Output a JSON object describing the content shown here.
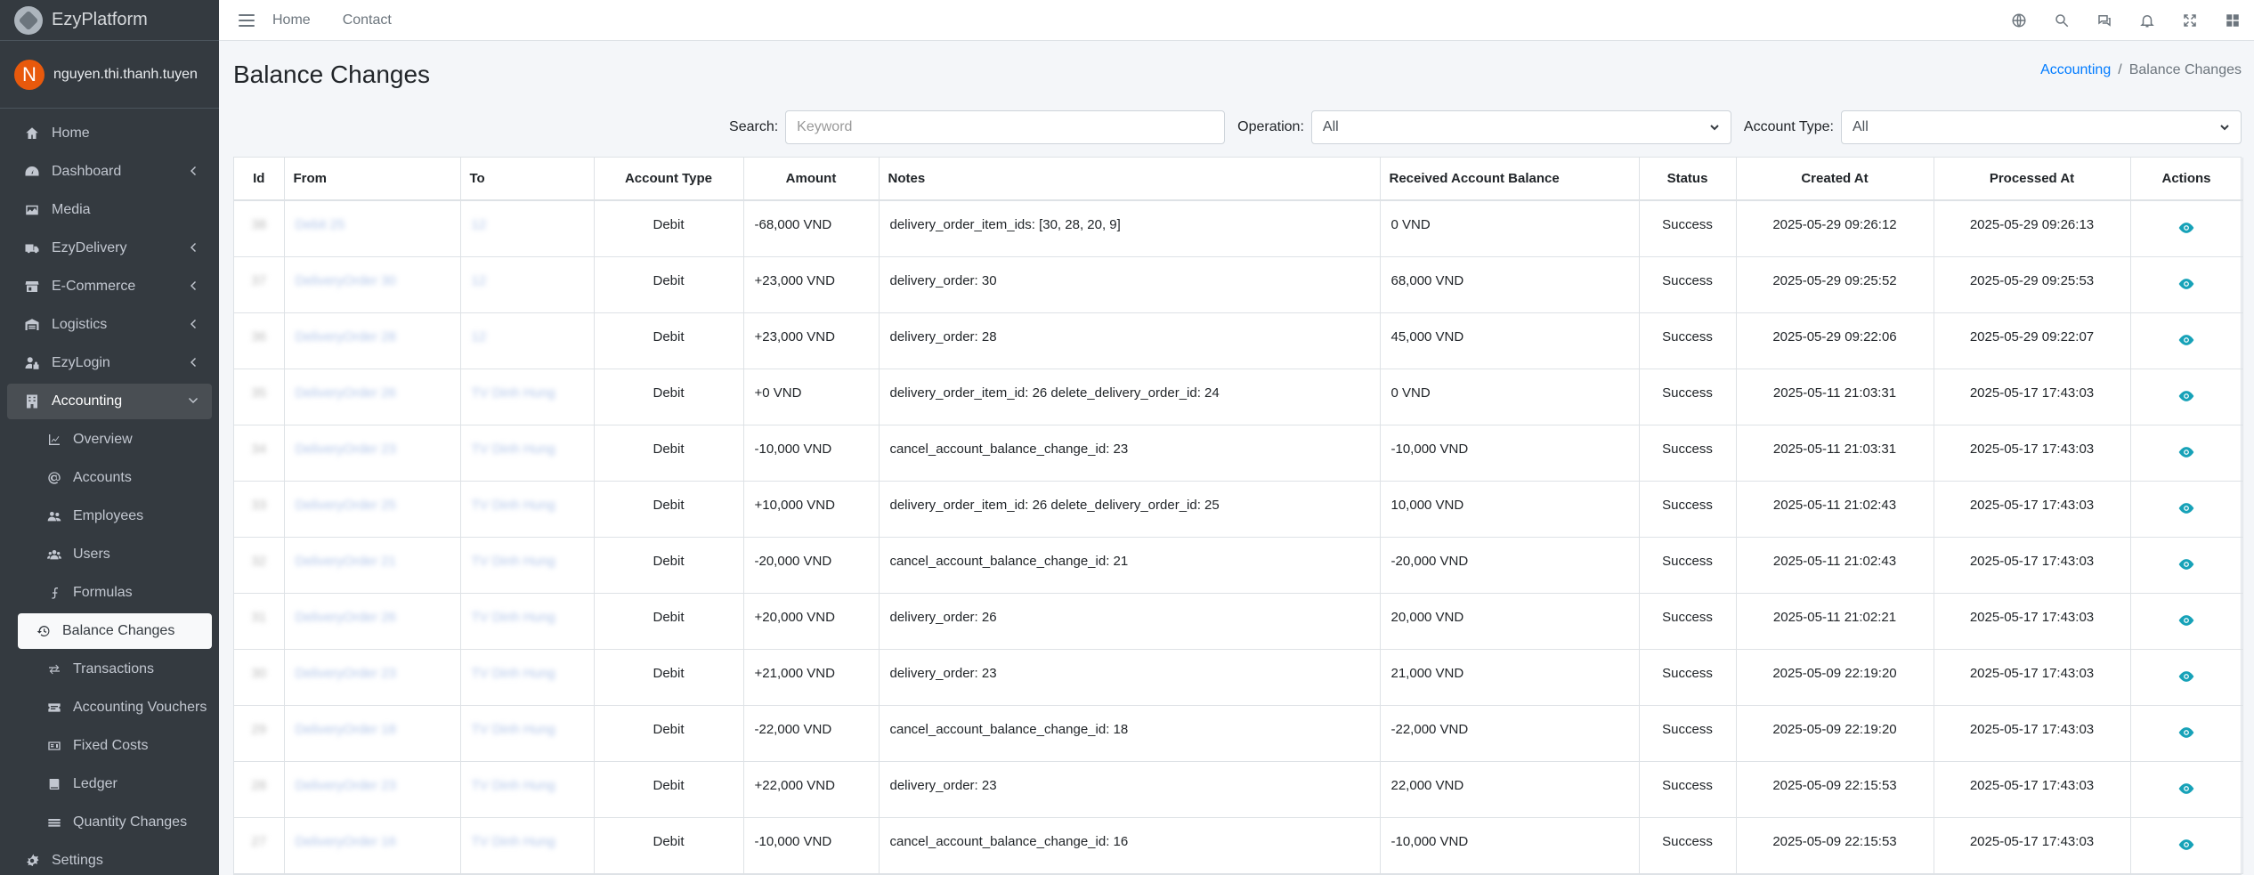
{
  "brand": {
    "name": "EzyPlatform"
  },
  "user": {
    "initial": "N",
    "name": "nguyen.thi.thanh.tuyen"
  },
  "sidebar": {
    "items": [
      {
        "label": "Home",
        "icon": "home-icon"
      },
      {
        "label": "Dashboard",
        "icon": "dashboard-icon",
        "chevron": true
      },
      {
        "label": "Media",
        "icon": "image-icon"
      },
      {
        "label": "EzyDelivery",
        "icon": "truck-icon",
        "chevron": true
      },
      {
        "label": "E-Commerce",
        "icon": "store-icon",
        "chevron": true
      },
      {
        "label": "Logistics",
        "icon": "warehouse-icon",
        "chevron": true
      },
      {
        "label": "EzyLogin",
        "icon": "user-lock-icon",
        "chevron": true
      },
      {
        "label": "Accounting",
        "icon": "building-icon",
        "chevron": true,
        "open": true
      }
    ],
    "accounting_sub": [
      "Overview",
      "Accounts",
      "Employees",
      "Users",
      "Formulas",
      "Balance Changes",
      "Transactions",
      "Accounting Vouchers",
      "Fixed Costs",
      "Ledger",
      "Quantity Changes"
    ],
    "settings": "Settings"
  },
  "topbar": {
    "home": "Home",
    "contact": "Contact"
  },
  "page": {
    "title": "Balance Changes"
  },
  "breadcrumb": {
    "parent": "Accounting",
    "separator": "/",
    "current": "Balance Changes"
  },
  "filters": {
    "search_label": "Search:",
    "search_placeholder": "Keyword",
    "operation_label": "Operation:",
    "operation_value": "All",
    "account_type_label": "Account Type:",
    "account_type_value": "All"
  },
  "table": {
    "headers": [
      "Id",
      "From",
      "To",
      "Account Type",
      "Amount",
      "Notes",
      "Received Account Balance",
      "Status",
      "Created At",
      "Processed At",
      "Actions"
    ],
    "rows": [
      {
        "id": "38",
        "from": "Debit 25",
        "to": "12",
        "type": "Debit",
        "amount": "-68,000 VND",
        "notes": "delivery_order_item_ids: [30, 28, 20, 9]",
        "balance": "0 VND",
        "status": "Success",
        "created": "2025-05-29 09:26:12",
        "processed": "2025-05-29 09:26:13"
      },
      {
        "id": "37",
        "from": "DeliveryOrder 30",
        "to": "12",
        "type": "Debit",
        "amount": "+23,000 VND",
        "notes": "delivery_order: 30",
        "balance": "68,000 VND",
        "status": "Success",
        "created": "2025-05-29 09:25:52",
        "processed": "2025-05-29 09:25:53"
      },
      {
        "id": "36",
        "from": "DeliveryOrder 28",
        "to": "12",
        "type": "Debit",
        "amount": "+23,000 VND",
        "notes": "delivery_order: 28",
        "balance": "45,000 VND",
        "status": "Success",
        "created": "2025-05-29 09:22:06",
        "processed": "2025-05-29 09:22:07"
      },
      {
        "id": "35",
        "from": "DeliveryOrder 26",
        "to": "TV Dinh Hung",
        "type": "Debit",
        "amount": "+0 VND",
        "notes": "delivery_order_item_id: 26 delete_delivery_order_id: 24",
        "balance": "0 VND",
        "status": "Success",
        "created": "2025-05-11 21:03:31",
        "processed": "2025-05-17 17:43:03"
      },
      {
        "id": "34",
        "from": "DeliveryOrder 23",
        "to": "TV Dinh Hung",
        "type": "Debit",
        "amount": "-10,000 VND",
        "notes": "cancel_account_balance_change_id: 23",
        "balance": "-10,000 VND",
        "status": "Success",
        "created": "2025-05-11 21:03:31",
        "processed": "2025-05-17 17:43:03"
      },
      {
        "id": "33",
        "from": "DeliveryOrder 25",
        "to": "TV Dinh Hung",
        "type": "Debit",
        "amount": "+10,000 VND",
        "notes": "delivery_order_item_id: 26 delete_delivery_order_id: 25",
        "balance": "10,000 VND",
        "status": "Success",
        "created": "2025-05-11 21:02:43",
        "processed": "2025-05-17 17:43:03"
      },
      {
        "id": "32",
        "from": "DeliveryOrder 21",
        "to": "TV Dinh Hung",
        "type": "Debit",
        "amount": "-20,000 VND",
        "notes": "cancel_account_balance_change_id: 21",
        "balance": "-20,000 VND",
        "status": "Success",
        "created": "2025-05-11 21:02:43",
        "processed": "2025-05-17 17:43:03"
      },
      {
        "id": "31",
        "from": "DeliveryOrder 26",
        "to": "TV Dinh Hung",
        "type": "Debit",
        "amount": "+20,000 VND",
        "notes": "delivery_order: 26",
        "balance": "20,000 VND",
        "status": "Success",
        "created": "2025-05-11 21:02:21",
        "processed": "2025-05-17 17:43:03"
      },
      {
        "id": "30",
        "from": "DeliveryOrder 23",
        "to": "TV Dinh Hung",
        "type": "Debit",
        "amount": "+21,000 VND",
        "notes": "delivery_order: 23",
        "balance": "21,000 VND",
        "status": "Success",
        "created": "2025-05-09 22:19:20",
        "processed": "2025-05-17 17:43:03"
      },
      {
        "id": "29",
        "from": "DeliveryOrder 18",
        "to": "TV Dinh Hung",
        "type": "Debit",
        "amount": "-22,000 VND",
        "notes": "cancel_account_balance_change_id: 18",
        "balance": "-22,000 VND",
        "status": "Success",
        "created": "2025-05-09 22:19:20",
        "processed": "2025-05-17 17:43:03"
      },
      {
        "id": "28",
        "from": "DeliveryOrder 23",
        "to": "TV Dinh Hung",
        "type": "Debit",
        "amount": "+22,000 VND",
        "notes": "delivery_order: 23",
        "balance": "22,000 VND",
        "status": "Success",
        "created": "2025-05-09 22:15:53",
        "processed": "2025-05-17 17:43:03"
      },
      {
        "id": "27",
        "from": "DeliveryOrder 16",
        "to": "TV Dinh Hung",
        "type": "Debit",
        "amount": "-10,000 VND",
        "notes": "cancel_account_balance_change_id: 16",
        "balance": "-10,000 VND",
        "status": "Success",
        "created": "2025-05-09 22:15:53",
        "processed": "2025-05-17 17:43:03"
      }
    ]
  },
  "colors": {
    "sidebar_bg": "#343a40",
    "link": "#007bff",
    "eye_icon": "#17a2b8"
  }
}
